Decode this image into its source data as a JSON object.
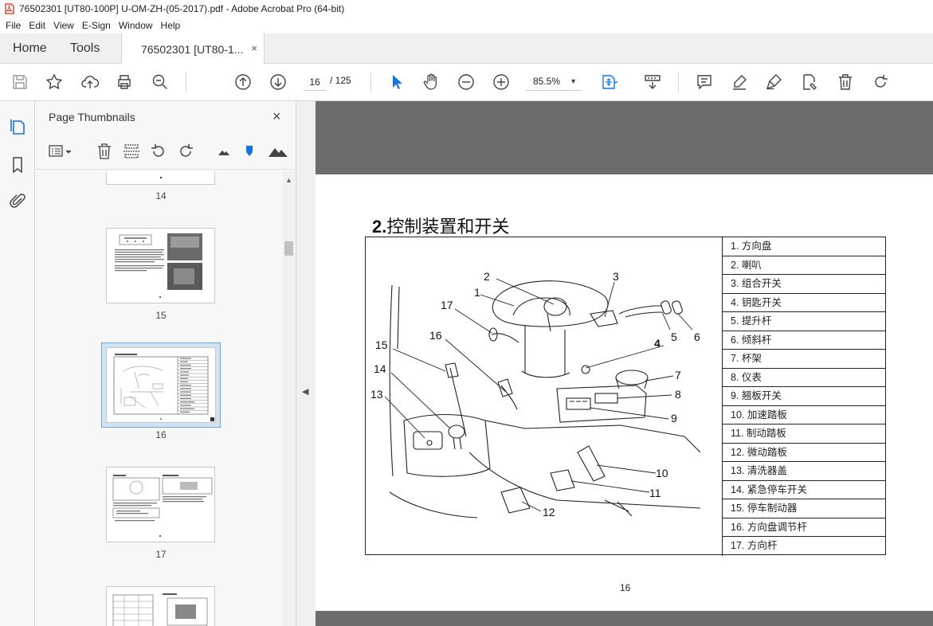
{
  "window": {
    "title": "76502301 [UT80-100P] U-OM-ZH-(05-2017).pdf - Adobe Acrobat Pro (64-bit)"
  },
  "menu": [
    "File",
    "Edit",
    "View",
    "E-Sign",
    "Window",
    "Help"
  ],
  "tabs": {
    "home": "Home",
    "tools": "Tools",
    "document": "76502301 [UT80-1...",
    "close": "×"
  },
  "toolbar": {
    "current_page": "16",
    "total_pages": "/ 125",
    "zoom": "85.5%"
  },
  "thumbnails_panel": {
    "title": "Page Thumbnails",
    "close": "×",
    "pages": [
      "14",
      "15",
      "16",
      "17"
    ],
    "selected": "16"
  },
  "document": {
    "section_number": "2.",
    "section_title": "控制装置和开关",
    "parts": [
      "1.  方向盘",
      "2.  喇叭",
      "3.  组合开关",
      "4.  钥匙开关",
      "5.  提升杆",
      "6.  倾斜杆",
      "7.  杯架",
      "8.  仪表",
      "9.  翘板开关",
      "10.  加速踏板",
      "11.  制动踏板",
      "12.  微动踏板",
      "13.  清洗器盖",
      "14.  紧急停车开关",
      "15.  停车制动器",
      "16.  方向盘调节杆",
      "17.  方向杆"
    ],
    "callouts": [
      "1",
      "2",
      "3",
      "4",
      "5",
      "6",
      "7",
      "8",
      "9",
      "10",
      "11",
      "12",
      "13",
      "14",
      "15",
      "16",
      "17"
    ],
    "page_number": "16"
  }
}
